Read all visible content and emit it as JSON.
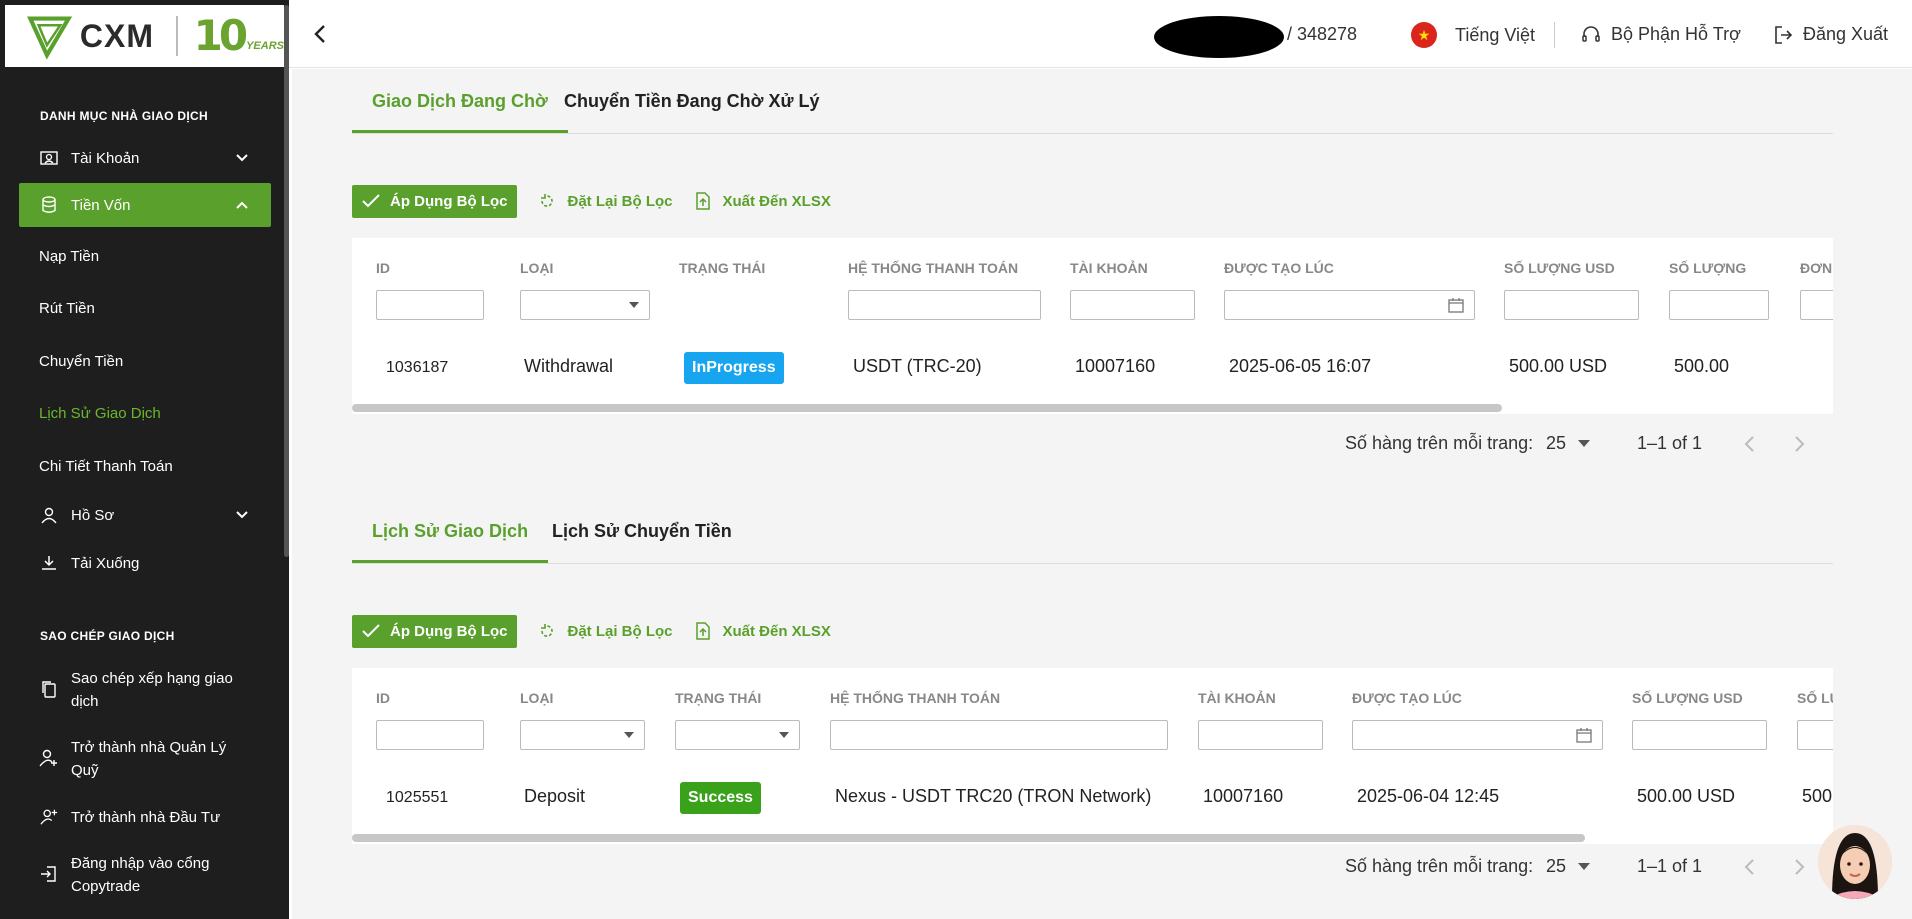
{
  "header": {
    "brand": "CXM",
    "anniversary_number": "10",
    "anniversary_word": "YEARS",
    "account_suffix": "/ 348278",
    "language": "Tiếng Việt",
    "support": "Bộ Phận Hỗ Trợ",
    "logout": "Đăng Xuất"
  },
  "sidebar": {
    "section1": "DANH MỤC NHÀ GIAO DỊCH",
    "account": "Tài Khoản",
    "funds": "Tiền Vốn",
    "deposit": "Nạp Tiền",
    "withdraw": "Rút Tiền",
    "transfer": "Chuyển Tiền",
    "history": "Lịch Sử Giao Dịch",
    "payment_details": "Chi Tiết Thanh Toán",
    "profile": "Hồ Sơ",
    "downloads": "Tải Xuống",
    "section2": "SAO CHÉP GIAO DỊCH",
    "copy_rank_l1": "Sao chép xếp hạng giao",
    "copy_rank_l2": "dịch",
    "fund_mgr_l1": "Trở thành nhà Quản Lý",
    "fund_mgr_l2": "Quỹ",
    "investor": "Trở thành nhà Đầu Tư",
    "copytrade_l1": "Đăng nhập vào cổng",
    "copytrade_l2": "Copytrade"
  },
  "pending": {
    "tab_active": "Giao Dịch Đang Chờ",
    "tab_other": "Chuyển Tiền Đang Chờ Xử Lý",
    "apply": "Áp Dụng Bộ Lọc",
    "reset": "Đặt Lại Bộ Lọc",
    "export": "Xuất Đến XLSX",
    "columns": [
      "ID",
      "LOẠI",
      "TRẠNG THÁI",
      "HỆ THỐNG THANH TOÁN",
      "TÀI KHOẢN",
      "ĐƯỢC TẠO LÚC",
      "SỐ LƯỢNG USD",
      "SỐ LƯỢNG",
      "ĐƠN V"
    ],
    "row": {
      "id": "1036187",
      "type": "Withdrawal",
      "status": "InProgress",
      "payment": "USDT (TRC-20)",
      "account": "10007160",
      "created": "2025-06-05 16:07",
      "usd": "500.00 USD",
      "amount": "500.00"
    },
    "rows_label": "Số hàng trên mỗi trang:",
    "rows_value": "25",
    "range": "1–1 of 1"
  },
  "history": {
    "tab_active": "Lịch Sử Giao Dịch",
    "tab_other": "Lịch Sử Chuyển Tiền",
    "apply": "Áp Dụng Bộ Lọc",
    "reset": "Đặt Lại Bộ Lọc",
    "export": "Xuất Đến XLSX",
    "columns": [
      "ID",
      "LOẠI",
      "TRẠNG THÁI",
      "HỆ THỐNG THANH TOÁN",
      "TÀI KHOẢN",
      "ĐƯỢC TẠO LÚC",
      "SỐ LƯỢNG USD",
      "SỐ LU"
    ],
    "row": {
      "id": "1025551",
      "type": "Deposit",
      "status": "Success",
      "payment": "Nexus - USDT TRC20 (TRON Network)",
      "account": "10007160",
      "created": "2025-06-04 12:45",
      "usd": "500.00 USD",
      "amount": "500"
    },
    "rows_label": "Số hàng trên mỗi trang:",
    "rows_value": "25",
    "range": "1–1 of 1"
  },
  "colors": {
    "accent": "#5aa02c",
    "sidebar_bg": "#1e1e1e",
    "in_progress": "#16a5ee",
    "success": "#3aa11b"
  }
}
